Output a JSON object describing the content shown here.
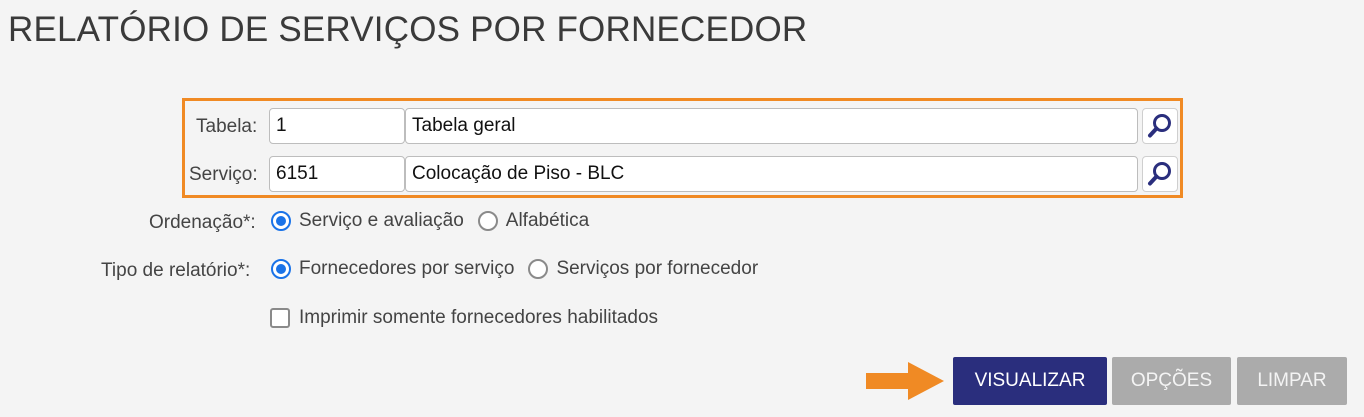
{
  "page": {
    "title": "RELATÓRIO DE SERVIÇOS POR FORNECEDOR"
  },
  "form": {
    "tabela": {
      "label": "Tabela:",
      "code": "1",
      "description": "Tabela geral"
    },
    "servico": {
      "label": "Serviço:",
      "code": "6151",
      "description": "Colocação de Piso - BLC"
    },
    "ordenacao": {
      "label": "Ordenação*:",
      "options": [
        "Serviço e avaliação",
        "Alfabética"
      ],
      "selected": "Serviço e avaliação"
    },
    "tipo_relatorio": {
      "label": "Tipo de relatório*:",
      "options": [
        "Fornecedores por serviço",
        "Serviços por fornecedor"
      ],
      "selected": "Fornecedores por serviço"
    },
    "somente_habilitados": {
      "label": "Imprimir somente fornecedores habilitados",
      "checked": false
    }
  },
  "actions": {
    "visualizar": "VISUALIZAR",
    "opcoes": "OPÇÕES",
    "limpar": "LIMPAR"
  },
  "icons": {
    "lookup": "magnifier-icon",
    "pointer": "arrow-right-icon"
  },
  "colors": {
    "highlight": "#f08a24",
    "primary": "#2a2e7d",
    "secondary": "#ababab",
    "radio": "#1a73e8"
  }
}
